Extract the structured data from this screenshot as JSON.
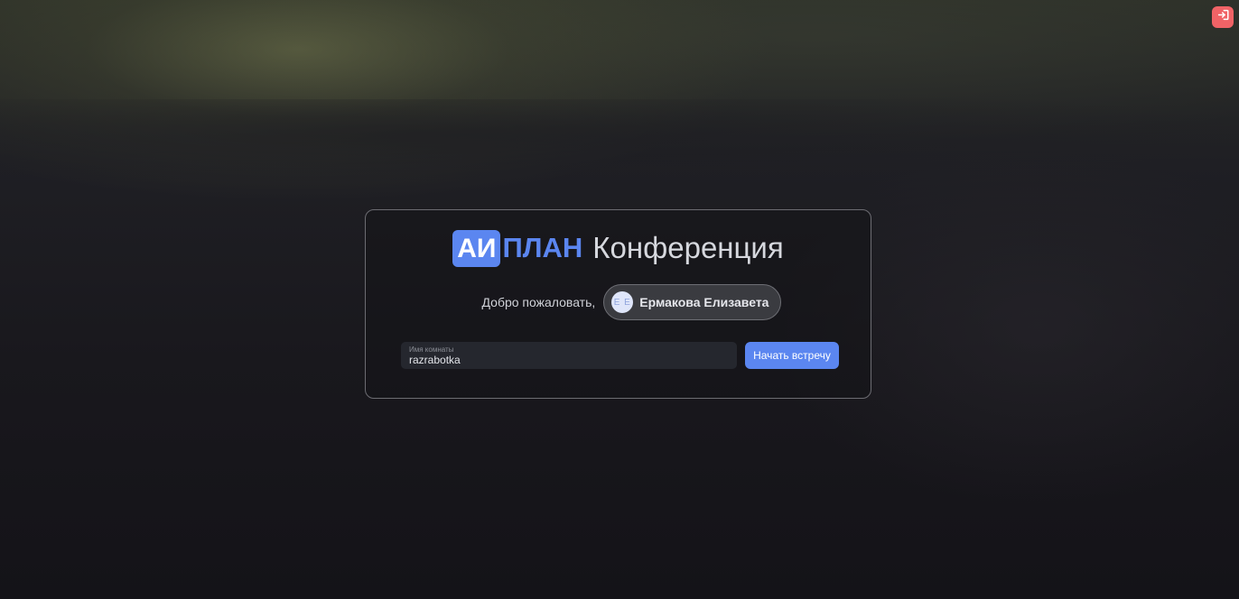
{
  "header": {
    "logout_icon": "logout-icon",
    "logout_color": "#f06366"
  },
  "card": {
    "logo_badge": "АИ",
    "logo_word": "ПЛАН",
    "title": "Конференция",
    "welcome": "Добро пожаловать,",
    "user": {
      "initials": "Е Е",
      "name": "Ермакова Елизавета"
    },
    "room": {
      "label": "Имя комнаты",
      "value": "razrabotka"
    },
    "start_button": "Начать встречу"
  },
  "colors": {
    "accent": "#5b86f0",
    "danger": "#f06366",
    "background": "#19181d"
  }
}
